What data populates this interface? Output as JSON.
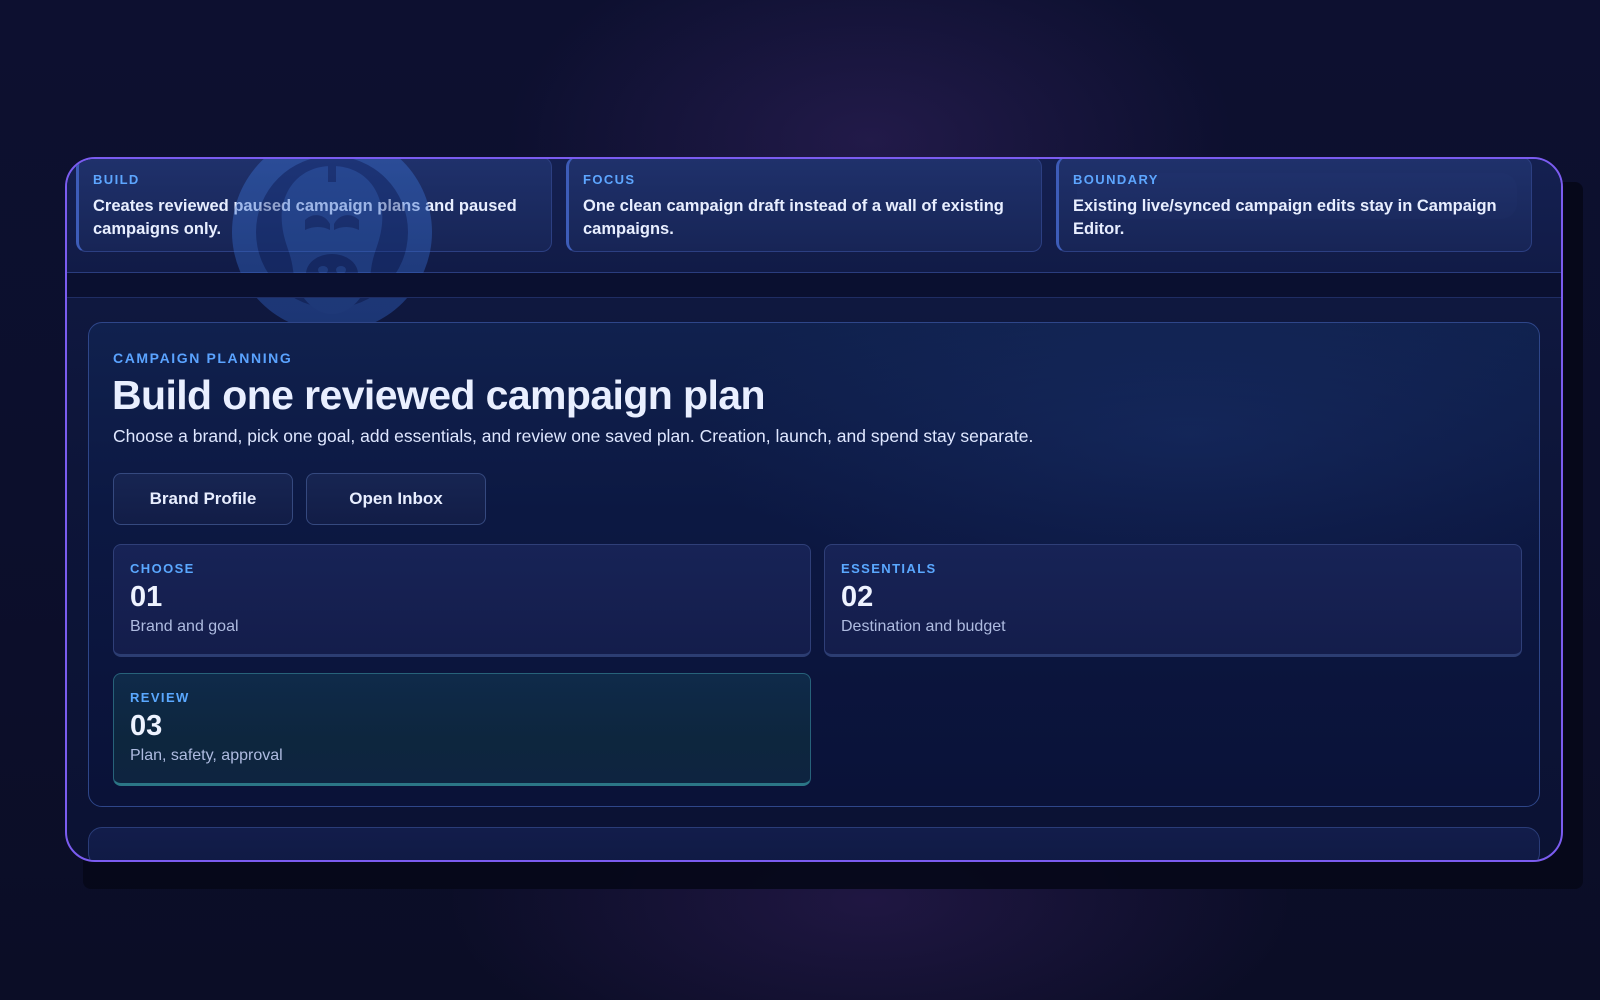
{
  "colors": {
    "accent": "#5aa3ff",
    "frame": "#7b5cf0",
    "background": "#0d1030"
  },
  "watermark": {
    "icon": "gorilla-logo-icon"
  },
  "info_pills": [
    {
      "label": "BUILD",
      "text": "Creates reviewed paused campaign plans and paused campaigns only."
    },
    {
      "label": "FOCUS",
      "text": "One clean campaign draft instead of a wall of existing campaigns."
    },
    {
      "label": "BOUNDARY",
      "text": "Existing live/synced campaign edits stay in Campaign Editor."
    }
  ],
  "hero": {
    "eyebrow": "CAMPAIGN PLANNING",
    "title": "Build one reviewed campaign plan",
    "subtitle": "Choose a brand, pick one goal, add essentials, and review one saved plan. Creation, launch, and spend stay separate."
  },
  "actions": {
    "brand_profile": "Brand Profile",
    "open_inbox": "Open Inbox"
  },
  "steps": [
    {
      "label": "CHOOSE",
      "number": "01",
      "description": "Brand and goal"
    },
    {
      "label": "ESSENTIALS",
      "number": "02",
      "description": "Destination and budget"
    },
    {
      "label": "REVIEW",
      "number": "03",
      "description": "Plan, safety, approval"
    }
  ]
}
